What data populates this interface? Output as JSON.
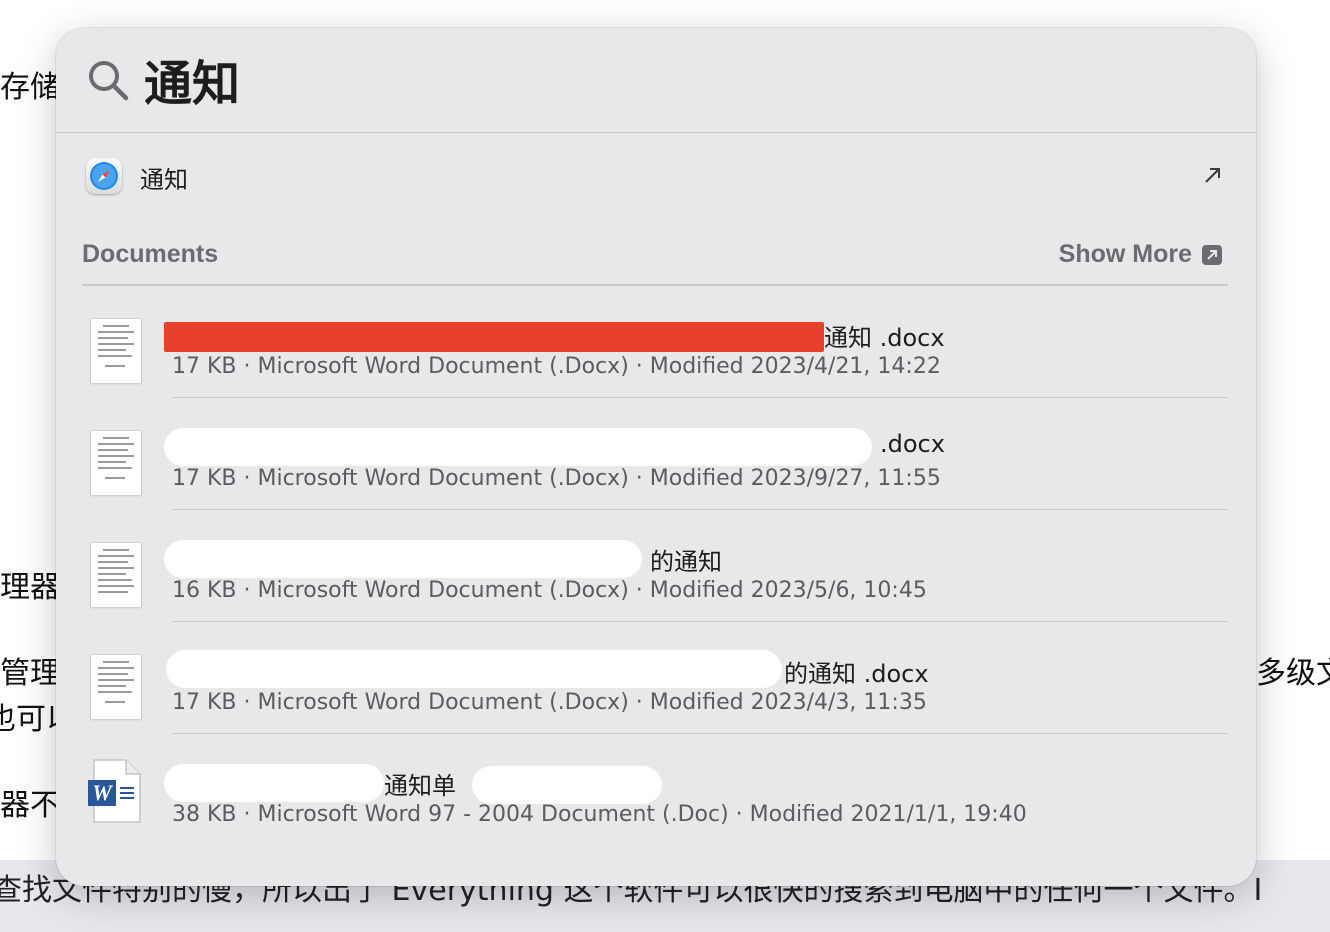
{
  "background": {
    "left_fragments": [
      "存储",
      "理器",
      "管理",
      "也可以",
      "器不"
    ],
    "right_fragment": "多级文",
    "bottom_line": "查找文件特别的慢，所以出了 Everything 这个软件可以很快的搜索到电脑中的任何一个文件。I"
  },
  "search": {
    "query": "通知",
    "icon": "magnifying-glass-icon"
  },
  "top_hit": {
    "label": "通知",
    "icon": "safari-icon",
    "action_icon": "open-arrow-icon"
  },
  "documents_section": {
    "title": "Documents",
    "show_more": "Show More"
  },
  "results": [
    {
      "name_visible": "通知 .docx",
      "meta": "17 KB · Microsoft Word Document (.Docx) · Modified 2023/4/21, 14:22",
      "icon": "docx-thumbnail-icon"
    },
    {
      "name_visible": ".docx",
      "meta": "17 KB · Microsoft Word Document (.Docx) · Modified 2023/9/27, 11:55",
      "icon": "docx-thumbnail-icon"
    },
    {
      "name_visible": "的通知",
      "meta": "16 KB · Microsoft Word Document (.Docx) · Modified 2023/5/6, 10:45",
      "icon": "docx-thumbnail-icon"
    },
    {
      "name_visible": "的通知 .docx",
      "meta": "17 KB · Microsoft Word Document (.Docx) · Modified 2023/4/3, 11:35",
      "icon": "docx-thumbnail-icon"
    },
    {
      "name_visible": "通知单",
      "meta": "38 KB · Microsoft Word 97 - 2004 Document (.Doc) · Modified 2021/1/1, 19:40",
      "icon": "word-doc-icon"
    }
  ],
  "colors": {
    "panel_bg": "#e8e8ea",
    "secondary_text": "#6c6c70",
    "redaction_red": "#e8402c"
  }
}
